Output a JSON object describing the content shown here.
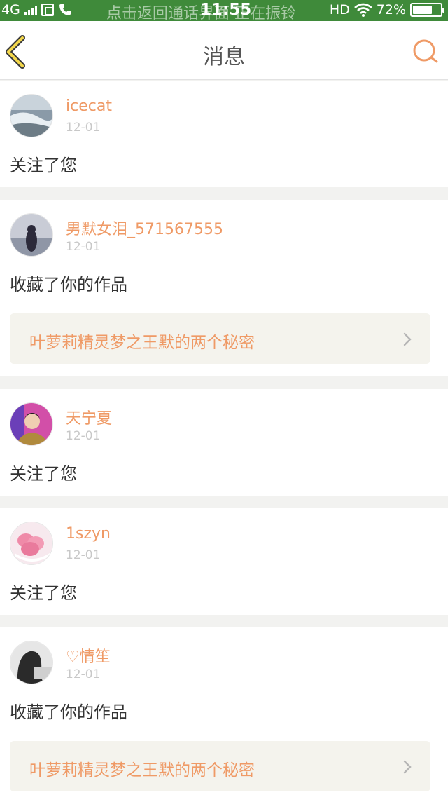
{
  "status_bar": {
    "network": "4G",
    "notification": "点击返回通话界面  正在振铃",
    "time": "11:55",
    "hd": "HD",
    "battery_percent": "72%",
    "battery_level": 0.72
  },
  "nav": {
    "title": "消息",
    "back_icon": "chevron-left-icon",
    "search_icon": "search-icon",
    "accent_color": "#ef9a66"
  },
  "messages": [
    {
      "username": "icecat",
      "date": "12-01",
      "action": "关注了您"
    },
    {
      "username": "男默女泪_571567555",
      "date": "12-01",
      "action": "收藏了你的作品",
      "work_title": "叶萝莉精灵梦之王默的两个秘密"
    },
    {
      "username": "天宁夏",
      "date": "12-01",
      "action": "关注了您"
    },
    {
      "username": "1szyn",
      "date": "12-01",
      "action": "关注了您"
    },
    {
      "username": "♡情笙",
      "date": "12-01",
      "action": "收藏了你的作品",
      "work_title": "叶萝莉精灵梦之王默的两个秘密"
    }
  ]
}
